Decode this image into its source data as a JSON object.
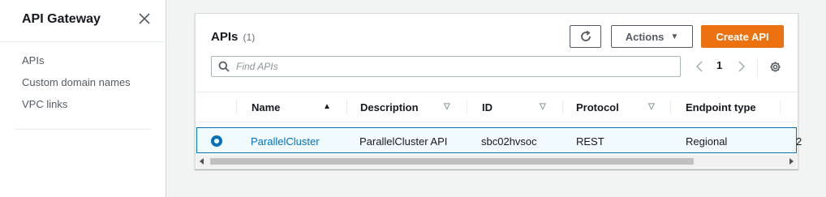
{
  "sidebar": {
    "title": "API Gateway",
    "items": [
      {
        "label": "APIs"
      },
      {
        "label": "Custom domain names"
      },
      {
        "label": "VPC links"
      }
    ]
  },
  "panel": {
    "title": "APIs",
    "count": "(1)",
    "actions_label": "Actions",
    "create_label": "Create API",
    "search_placeholder": "Find APIs",
    "page_number": "1"
  },
  "table": {
    "columns": [
      {
        "label": "Name",
        "sort": "ascending"
      },
      {
        "label": "Description",
        "sort": "none"
      },
      {
        "label": "ID",
        "sort": "none"
      },
      {
        "label": "Protocol",
        "sort": "none"
      },
      {
        "label": "Endpoint type",
        "sort": "none"
      }
    ],
    "rows": [
      {
        "selected": true,
        "name": "ParallelCluster",
        "description": "ParallelCluster API",
        "id": "sbc02hvsoc",
        "protocol": "REST",
        "endpoint_type": "Regional",
        "next_col_partial": "2"
      }
    ]
  },
  "colors": {
    "accent": "#ec7211",
    "link": "#0073bb",
    "selected_row_bg": "#f1faff"
  }
}
